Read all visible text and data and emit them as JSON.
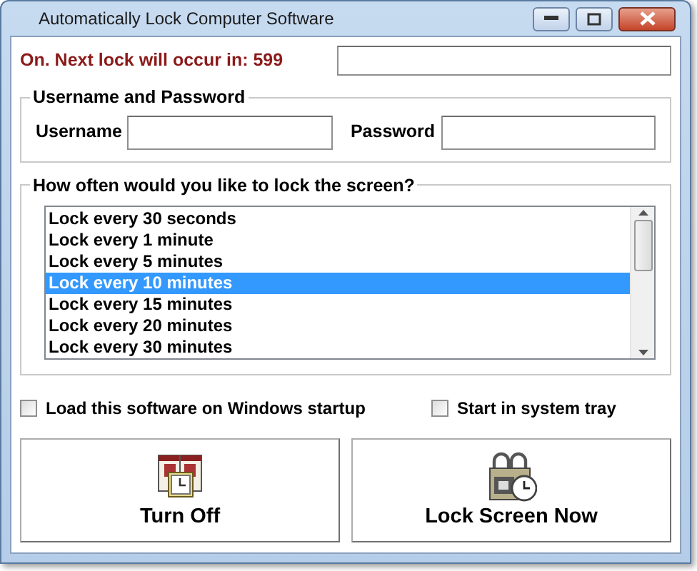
{
  "window": {
    "title": "Automatically Lock Computer Software"
  },
  "status": {
    "text": "On. Next lock will occur in: 599"
  },
  "credentials": {
    "title": "Username and Password",
    "username_label": "Username",
    "password_label": "Password"
  },
  "interval": {
    "title": "How often would you like to lock the screen?",
    "options": [
      {
        "label": "Lock every 30 seconds",
        "selected": false
      },
      {
        "label": "Lock every 1 minute",
        "selected": false
      },
      {
        "label": "Lock every 5 minutes",
        "selected": false
      },
      {
        "label": "Lock every 10 minutes",
        "selected": true
      },
      {
        "label": "Lock every 15 minutes",
        "selected": false
      },
      {
        "label": "Lock every 20 minutes",
        "selected": false
      },
      {
        "label": "Lock every 30 minutes",
        "selected": false
      }
    ]
  },
  "options": [
    {
      "label": "Load this software on Windows startup",
      "checked": false
    },
    {
      "label": "Start in system tray",
      "checked": false
    }
  ],
  "buttons": [
    {
      "label": "Turn Off",
      "kind": "calendar"
    },
    {
      "label": "Lock Screen Now",
      "kind": "lock"
    }
  ]
}
